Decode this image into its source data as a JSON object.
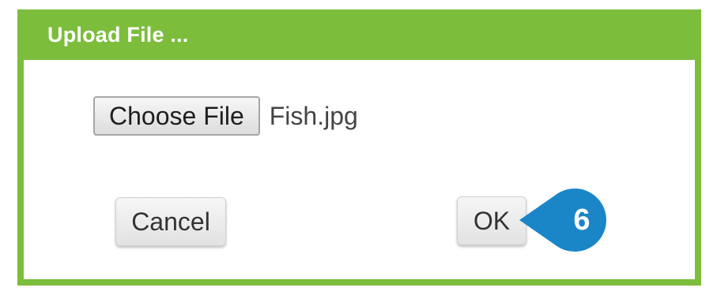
{
  "dialog": {
    "title": "Upload File ...",
    "choose_file_label": "Choose File",
    "selected_file": "Fish.jpg",
    "cancel_label": "Cancel",
    "ok_label": "OK"
  },
  "callout": {
    "number": "6",
    "color": "#1a86c8"
  },
  "colors": {
    "frame": "#7cbd3c",
    "title_text": "#ffffff"
  }
}
